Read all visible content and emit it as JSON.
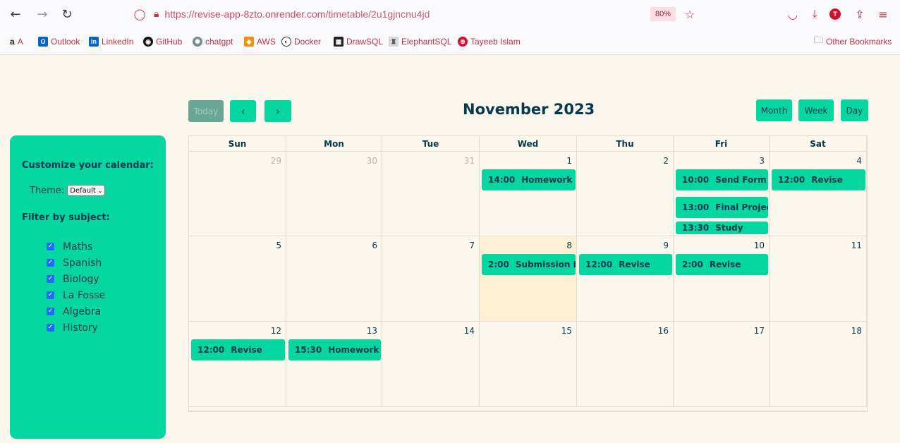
{
  "browser": {
    "url_host": "https://revise-app-8zto.onrender.com",
    "url_path": "/timetable/2u1gjncnu4jd",
    "zoom": "80%",
    "avatar_letter": "T"
  },
  "bookmarks": [
    {
      "label": "A",
      "icon": "amazon-icon"
    },
    {
      "label": "Outlook",
      "icon": "outlook-icon"
    },
    {
      "label": "LinkedIn",
      "icon": "linkedin-icon"
    },
    {
      "label": "GitHub",
      "icon": "github-icon"
    },
    {
      "label": "chatgpt",
      "icon": "chatgpt-icon"
    },
    {
      "label": "AWS",
      "icon": "aws-icon"
    },
    {
      "label": "Docker",
      "icon": "docker-icon"
    },
    {
      "label": "DrawSQL",
      "icon": "drawsql-icon"
    },
    {
      "label": "ElephantSQL",
      "icon": "elephantsql-icon"
    },
    {
      "label": "Tayeeb Islam",
      "icon": "globe-icon"
    }
  ],
  "other_bookmarks": "Other Bookmarks",
  "sidebar": {
    "customize_title": "Customize your calendar:",
    "theme_label": "Theme:",
    "theme_value": "Default",
    "filter_title": "Filter by subject:",
    "subjects": [
      "Maths",
      "Spanish",
      "Biology",
      "La Fosse",
      "Algebra",
      "History"
    ]
  },
  "calendar": {
    "today_label": "Today",
    "title": "November 2023",
    "month_label": "Month",
    "week_label": "Week",
    "day_label": "Day",
    "weekdays": [
      "Sun",
      "Mon",
      "Tue",
      "Wed",
      "Thu",
      "Fri",
      "Sat"
    ],
    "weeks": [
      [
        "29",
        "30",
        "31",
        "1",
        "2",
        "3",
        "4"
      ],
      [
        "5",
        "6",
        "7",
        "8",
        "9",
        "10",
        "11"
      ],
      [
        "12",
        "13",
        "14",
        "15",
        "16",
        "17",
        "18"
      ]
    ],
    "events": [
      {
        "week": 0,
        "day": 3,
        "slot": 0,
        "time": "14:00",
        "title": "Homework"
      },
      {
        "week": 0,
        "day": 5,
        "slot": 0,
        "time": "10:00",
        "title": "Send Form"
      },
      {
        "week": 0,
        "day": 5,
        "slot": 1,
        "time": "13:00",
        "title": "Final Project"
      },
      {
        "week": 0,
        "day": 5,
        "slot": 2,
        "time": "13:30",
        "title": "Study"
      },
      {
        "week": 0,
        "day": 6,
        "slot": 0,
        "time": "12:00",
        "title": "Revise"
      },
      {
        "week": 1,
        "day": 3,
        "slot": 0,
        "time": "2:00",
        "title": "Submission Deadline"
      },
      {
        "week": 1,
        "day": 4,
        "slot": 0,
        "time": "12:00",
        "title": "Revise"
      },
      {
        "week": 1,
        "day": 5,
        "slot": 0,
        "time": "2:00",
        "title": "Revise"
      },
      {
        "week": 2,
        "day": 0,
        "slot": 0,
        "time": "12:00",
        "title": "Revise"
      },
      {
        "week": 2,
        "day": 1,
        "slot": 0,
        "time": "15:30",
        "title": "Homework"
      }
    ]
  },
  "colors": {
    "accent": "#06d6a0",
    "text_dark": "#08384d",
    "page_bg": "#fbf7ec",
    "today_bg": "#fcefd4"
  }
}
